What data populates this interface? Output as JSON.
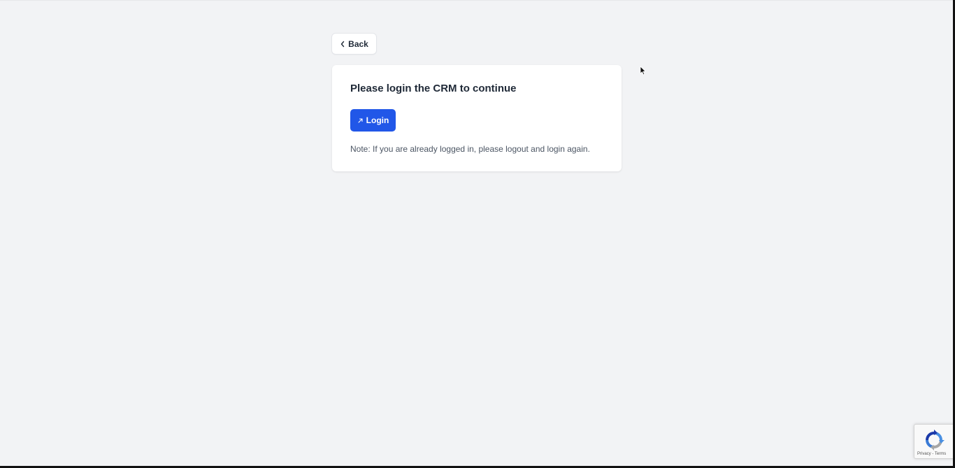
{
  "back_button": {
    "label": "Back",
    "icon": "chevron-left-icon"
  },
  "card": {
    "title": "Please login the CRM to continue",
    "login_button": {
      "label": "Login",
      "icon": "arrow-up-right-icon"
    },
    "note": "Note: If you are already logged in, please logout and login again."
  },
  "recaptcha": {
    "privacy": "Privacy",
    "separator": " - ",
    "terms": "Terms"
  },
  "colors": {
    "background": "#f2f3f5",
    "primary": "#2157e8",
    "card": "#ffffff"
  }
}
